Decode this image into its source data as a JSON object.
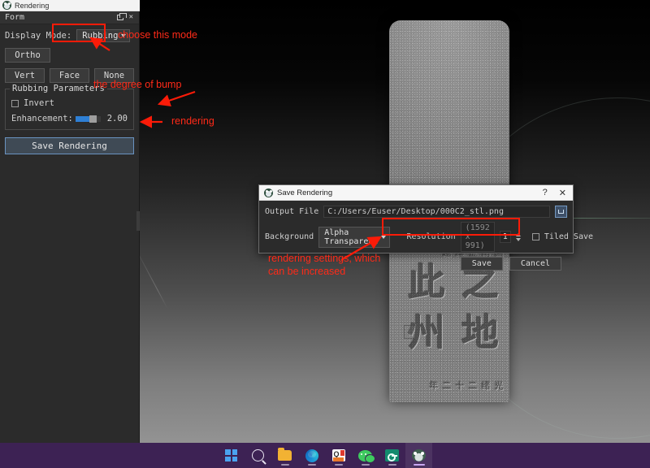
{
  "app": {
    "titlebar_text": "Rendering",
    "logo_icon": "panda-app-icon"
  },
  "dock": {
    "title": "Form",
    "float_icon": "undock-icon",
    "close_icon": "close-icon",
    "display_mode_label": "Display Mode:",
    "display_mode_value": "Rubbing",
    "ortho_button": "Ortho",
    "vert_button": "Vert",
    "face_button": "Face",
    "none_button": "None",
    "group_title": "Rubbing Parameters",
    "invert_label": "Invert",
    "enhancement_label": "Enhancement:",
    "enhancement_value": "2.00",
    "enhancement_fill_percent": 57,
    "save_rendering_button": "Save Rendering"
  },
  "dialog": {
    "title": "Save Rendering",
    "logo_icon": "panda-app-icon",
    "help_icon": "?",
    "close_icon": "✕",
    "output_file_label": "Output File",
    "output_file_value": "C:/Users/Euser/Desktop/000C2_stl.png",
    "browse_icon": "folder-browse-icon",
    "background_label": "Background",
    "background_value": "Alpha Transparent",
    "resolution_label": "Resolution",
    "resolution_placeholder": "(1592 x 991)",
    "resolution_scale_value": "1",
    "tiled_save_label": "Tiled Save",
    "save_button": "Save",
    "cancel_button": "Cancel"
  },
  "annotations": {
    "choose_mode": "choose this mode",
    "degree_of_bump": "the  degree of bump",
    "rendering": "rendering",
    "rendering_settings": "rendering settings, which\ncan be increased",
    "accent_color": "#fb1b08"
  },
  "viewport": {
    "stele_columns": {
      "right_small": "光绪二十二年",
      "big_top": "地州",
      "big_bottom": "之此",
      "signature": "国南金耀题"
    }
  },
  "taskbar": {
    "items": [
      {
        "name": "start-button",
        "icon": "windows-start-icon",
        "active": false
      },
      {
        "name": "search-button",
        "icon": "search-icon",
        "active": false
      },
      {
        "name": "file-explorer-button",
        "icon": "folder-icon",
        "active": false
      },
      {
        "name": "edge-browser-button",
        "icon": "edge-icon",
        "active": false
      },
      {
        "name": "qq-button",
        "icon": "qq-icon",
        "active": false
      },
      {
        "name": "wechat-button",
        "icon": "wechat-icon",
        "active": false
      },
      {
        "name": "password-manager-button",
        "icon": "key-icon",
        "active": false
      },
      {
        "name": "rendering-app-button",
        "icon": "panda-app-icon",
        "active": true
      }
    ]
  }
}
